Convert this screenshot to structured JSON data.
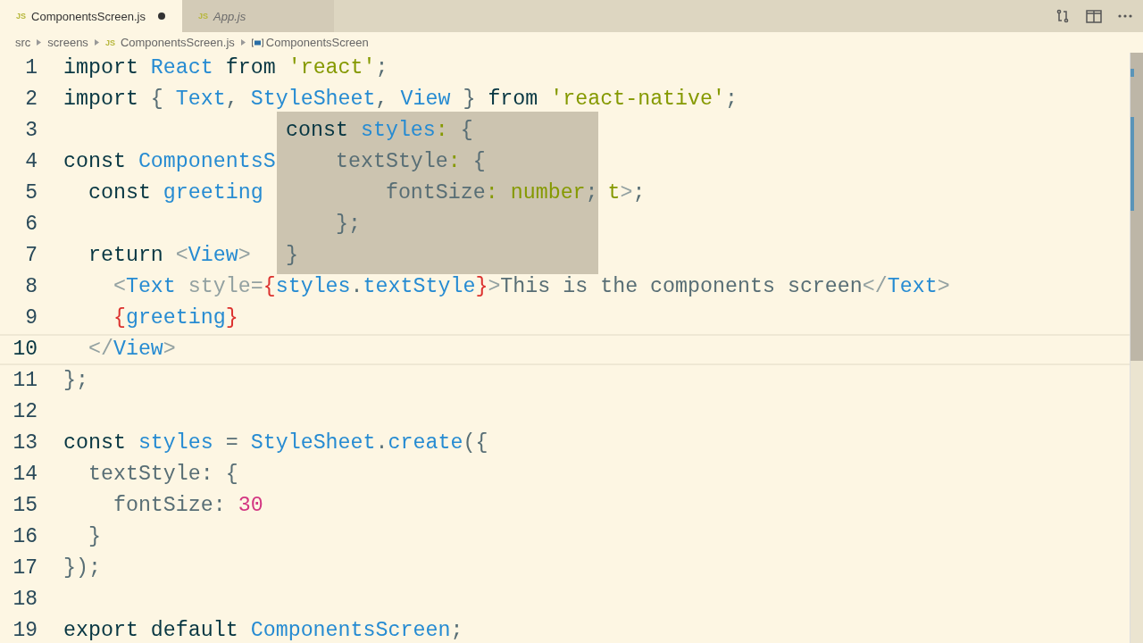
{
  "tabs": [
    {
      "label": "ComponentsScreen.js",
      "icon": "JS",
      "selected": true,
      "modified": true,
      "preview": false
    },
    {
      "label": "App.js",
      "icon": "JS",
      "selected": false,
      "modified": false,
      "preview": true
    }
  ],
  "breadcrumb": [
    {
      "label": "src",
      "kind": "folder"
    },
    {
      "label": "screens",
      "kind": "folder"
    },
    {
      "label": "ComponentsScreen.js",
      "kind": "file",
      "icon": "JS"
    },
    {
      "label": "ComponentsScreen",
      "kind": "symbol"
    }
  ],
  "editor": {
    "lines": [
      {
        "number": "1",
        "current": false,
        "tokens": [
          {
            "text": "import",
            "kind": "kw"
          },
          {
            "text": " React ",
            "kind": "var"
          },
          {
            "text": "from",
            "kind": "kw"
          },
          {
            "text": " 'react'",
            "kind": "str"
          },
          {
            "text": ";",
            "kind": "punc"
          }
        ]
      },
      {
        "number": "2",
        "current": false,
        "tokens": [
          {
            "text": "import",
            "kind": "kw"
          },
          {
            "text": " { ",
            "kind": "punc"
          },
          {
            "text": "Text",
            "kind": "var"
          },
          {
            "text": ", ",
            "kind": "punc"
          },
          {
            "text": "StyleSheet",
            "kind": "var"
          },
          {
            "text": ", ",
            "kind": "punc"
          },
          {
            "text": "View",
            "kind": "var"
          },
          {
            "text": " } ",
            "kind": "punc"
          },
          {
            "text": "from",
            "kind": "kw"
          },
          {
            "text": " 'react-native'",
            "kind": "str"
          },
          {
            "text": ";",
            "kind": "punc"
          }
        ]
      },
      {
        "number": "3",
        "current": false
      },
      {
        "number": "4",
        "current": false,
        "tokens": [
          {
            "text": "const",
            "kind": "kw"
          },
          {
            "text": " ComponentsS",
            "kind": "var"
          }
        ]
      },
      {
        "number": "5",
        "current": false,
        "tokens": [
          {
            "text": "  const",
            "kind": "kw"
          },
          {
            "text": " greeting",
            "kind": "var"
          }
        ],
        "after_hover": [
          {
            "text": "t",
            "kind": "str"
          },
          {
            "text": ">",
            "kind": "tag"
          },
          {
            "text": ";",
            "kind": "punc"
          }
        ]
      },
      {
        "number": "6",
        "current": false
      },
      {
        "number": "7",
        "current": false,
        "tokens": [
          {
            "text": "  return",
            "kind": "kw"
          },
          {
            "text": " <",
            "kind": "tag"
          },
          {
            "text": "View",
            "kind": "var"
          },
          {
            "text": ">",
            "kind": "tag"
          }
        ]
      },
      {
        "number": "8",
        "current": false,
        "tokens": [
          {
            "text": "    <",
            "kind": "tag"
          },
          {
            "text": "Text",
            "kind": "var"
          },
          {
            "text": " style=",
            "kind": "tag"
          },
          {
            "text": "{",
            "kind": "brace"
          },
          {
            "text": "styles",
            "kind": "var"
          },
          {
            "text": ".",
            "kind": "punc"
          },
          {
            "text": "textStyle",
            "kind": "var"
          },
          {
            "text": "}",
            "kind": "brace"
          },
          {
            "text": ">",
            "kind": "tag"
          },
          {
            "text": "This is the components screen",
            "kind": "text"
          },
          {
            "text": "</",
            "kind": "tag"
          },
          {
            "text": "Text",
            "kind": "var"
          },
          {
            "text": ">",
            "kind": "tag"
          }
        ]
      },
      {
        "number": "9",
        "current": false,
        "tokens": [
          {
            "text": "    {",
            "kind": "brace"
          },
          {
            "text": "greeting",
            "kind": "var"
          },
          {
            "text": "}",
            "kind": "brace"
          }
        ]
      },
      {
        "number": "10",
        "current": true,
        "tokens": [
          {
            "text": "  </",
            "kind": "tag"
          },
          {
            "text": "View",
            "kind": "var"
          },
          {
            "text": ">",
            "kind": "tag"
          }
        ]
      },
      {
        "number": "11",
        "current": false,
        "tokens": [
          {
            "text": "};",
            "kind": "punc"
          }
        ]
      },
      {
        "number": "12",
        "current": false
      },
      {
        "number": "13",
        "current": false,
        "tokens": [
          {
            "text": "const",
            "kind": "kw"
          },
          {
            "text": " styles",
            "kind": "var"
          },
          {
            "text": " = ",
            "kind": "punc"
          },
          {
            "text": "StyleSheet",
            "kind": "var"
          },
          {
            "text": ".",
            "kind": "punc"
          },
          {
            "text": "create",
            "kind": "var"
          },
          {
            "text": "({",
            "kind": "punc"
          }
        ]
      },
      {
        "number": "14",
        "current": false,
        "tokens": [
          {
            "text": "  textStyle",
            "kind": "prop"
          },
          {
            "text": ": {",
            "kind": "punc"
          }
        ]
      },
      {
        "number": "15",
        "current": false,
        "tokens": [
          {
            "text": "    fontSize",
            "kind": "prop"
          },
          {
            "text": ": ",
            "kind": "punc"
          },
          {
            "text": "30",
            "kind": "num"
          }
        ]
      },
      {
        "number": "16",
        "current": false,
        "tokens": [
          {
            "text": "  }",
            "kind": "punc"
          }
        ]
      },
      {
        "number": "17",
        "current": false,
        "tokens": [
          {
            "text": "});",
            "kind": "punc"
          }
        ]
      },
      {
        "number": "18",
        "current": false
      },
      {
        "number": "19",
        "current": false,
        "tokens": [
          {
            "text": "export",
            "kind": "kw"
          },
          {
            "text": " default",
            "kind": "kw"
          },
          {
            "text": " ComponentsScreen",
            "kind": "var"
          },
          {
            "text": ";",
            "kind": "punc"
          }
        ]
      }
    ]
  },
  "hover": {
    "lines": [
      {
        "tokens": [
          {
            "text": "const",
            "kind": "kw"
          },
          {
            "text": " styles",
            "kind": "var"
          },
          {
            "text": ":",
            "kind": "str"
          },
          {
            "text": " {",
            "kind": "punc"
          }
        ]
      },
      {
        "tokens": [
          {
            "text": "    textStyle",
            "kind": "prop"
          },
          {
            "text": ":",
            "kind": "str"
          },
          {
            "text": " {",
            "kind": "punc"
          }
        ]
      },
      {
        "tokens": [
          {
            "text": "        fontSize",
            "kind": "prop"
          },
          {
            "text": ":",
            "kind": "str"
          },
          {
            "text": " number",
            "kind": "str"
          },
          {
            "text": ";",
            "kind": "punc"
          }
        ]
      },
      {
        "tokens": [
          {
            "text": "    };",
            "kind": "punc"
          }
        ]
      },
      {
        "tokens": [
          {
            "text": "}",
            "kind": "punc"
          }
        ]
      }
    ]
  }
}
